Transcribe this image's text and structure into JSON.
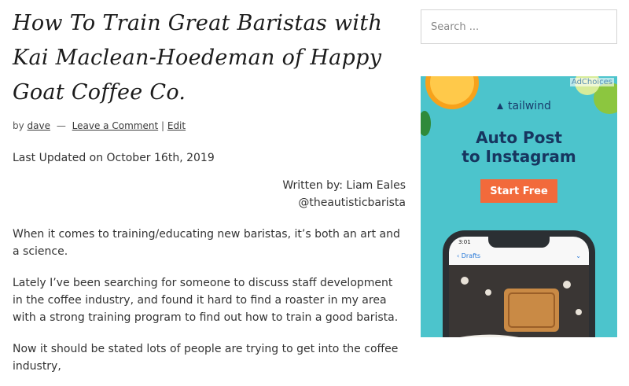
{
  "article": {
    "title": "How To Train Great Baristas with Kai Maclean-Hoedeman of Happy Goat Coffee Co.",
    "by": "by",
    "author": "dave",
    "separator": "—",
    "comment_link": "Leave a Comment",
    "pipe": "|",
    "edit_link": "Edit",
    "last_updated": "Last Updated on October 16th, 2019",
    "written_by": "Written by: Liam Eales",
    "handle": "@theautisticbarista",
    "paragraphs": [
      "When it comes to training/educating new baristas, it’s both an art and a science.",
      "Lately I’ve been searching for someone to discuss staff development in the coffee industry, and found it hard to find a roaster in my area with a strong training program to find out how to train a good barista.",
      "Now it should be stated lots of people are trying to get into the coffee industry,"
    ]
  },
  "sidebar": {
    "search_placeholder": "Search ..."
  },
  "ad": {
    "adchoices": "AdChoices",
    "brand": "tailwind",
    "headline_line1": "Auto Post",
    "headline_line2": "to Instagram",
    "cta": "Start Free",
    "phone_time": "3:01",
    "phone_back": "Drafts",
    "colors": {
      "background": "#4cc4cc",
      "cta": "#f26a3b",
      "headline": "#17355f"
    }
  }
}
